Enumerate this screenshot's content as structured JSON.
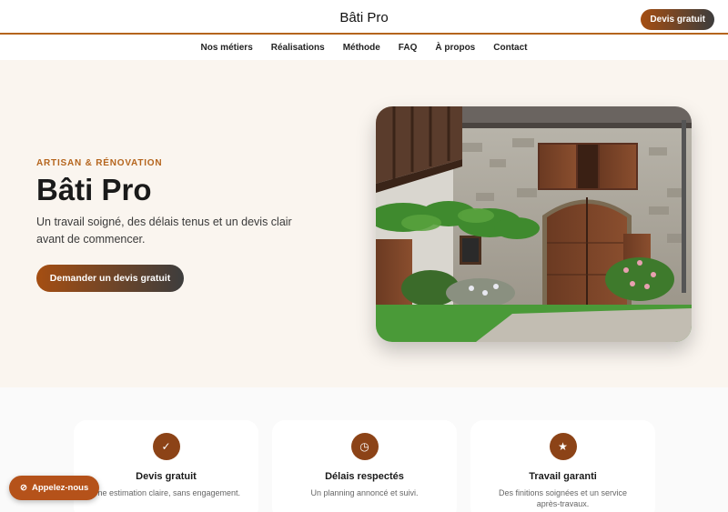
{
  "header": {
    "brand": "Bâti Pro",
    "cta_label": "Devis gratuit"
  },
  "nav": {
    "items": [
      {
        "label": "Nos métiers"
      },
      {
        "label": "Réalisations"
      },
      {
        "label": "Méthode"
      },
      {
        "label": "FAQ"
      },
      {
        "label": "À propos"
      },
      {
        "label": "Contact"
      }
    ]
  },
  "hero": {
    "eyebrow": "ARTISAN & RÉNOVATION",
    "title": "Bâti Pro",
    "text": "Un travail soigné, des délais tenus et un devis clair avant de commencer.",
    "button_label": "Demander un devis gratuit"
  },
  "features": [
    {
      "icon": "check-icon",
      "title": "Devis gratuit",
      "text": "Une estimation claire, sans engagement."
    },
    {
      "icon": "clock-icon",
      "title": "Délais respectés",
      "text": "Un planning annoncé et suivi."
    },
    {
      "icon": "star-icon",
      "title": "Travail garanti",
      "text": "Des finitions soignées et un service après-travaux."
    }
  ],
  "floating": {
    "call_label": "Appelez-nous"
  },
  "colors": {
    "accent": "#b5651d",
    "accent_dark": "#8c4317",
    "hero_bg": "#faf5ef"
  }
}
